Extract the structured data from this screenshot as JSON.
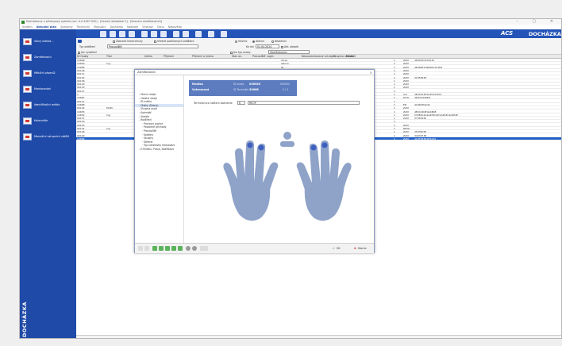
{
  "window": {
    "title": "Docházkový a přístupový systém (ver. 4.0.2467.550) - [Území/ databáze 2] - [Seznam zaměstnanců]"
  },
  "menu": [
    "Systém",
    "Aktuální plán",
    "Seznamy",
    "Technický",
    "Manuální",
    "Docházka",
    "Nástroje",
    "Výstupy",
    "Okno",
    "Nápověda"
  ],
  "menu_active_index": 1,
  "toolbar": {
    "brand": "ACS",
    "product": "DOCHÁZKA"
  },
  "sidebar": {
    "items": [
      {
        "label": "Volný dokkol...",
        "icon": "monitor-icon"
      },
      {
        "label": "Zaměstnanci",
        "icon": "people-icon"
      },
      {
        "label": "Měsíční zásení2",
        "icon": "calendar-icon"
      },
      {
        "label": "Montorování",
        "icon": "monitor-icon"
      },
      {
        "label": "Identifikační média",
        "icon": "card-icon"
      },
      {
        "label": "Kalendáře",
        "icon": "calendar-icon"
      },
      {
        "label": "Manuální vstupních zátěží",
        "icon": "list-icon"
      }
    ],
    "vertical_label": "DOCHÁZKA"
  },
  "filters": {
    "structure_label": "Zobrazit hierarchicky",
    "include_sub_label": "Včetně podřízených oddělení",
    "type_label": "Typ oddělení",
    "type_value": "Pracoviště",
    "radio_all": "Všichni",
    "radio_active": "Aktivní",
    "radio_inactive": "Neaktivní",
    "date_label": "Ke dni",
    "date_value": "01.04.2024",
    "aktiv_label": "Akt. období",
    "left_chk": "Jen vyzdílení",
    "left_chk2": "Jen typ osoby",
    "person_type": "Zaměstnanec"
  },
  "grid": {
    "headers": [
      "ID Osoby",
      "Titul",
      "Jméno",
      "Příjmení",
      "Příjmení a jméno",
      "Stav os.",
      "Pracoviště",
      "Login",
      "Nesoustrukovaný od segm.",
      "Skupina uživatelů",
      "Média"
    ],
    "rows": [
      [
        "10608",
        "",
        "",
        "",
        "",
        "",
        "",
        "dlova",
        "",
        "1",
        "ZAM",
        "465543C4A1032"
      ],
      [
        "10659",
        "Ing.",
        "",
        "",
        "",
        "",
        "",
        "elkova",
        "",
        "1",
        "ZAM",
        ""
      ],
      [
        "10689",
        "",
        "",
        "",
        "",
        "",
        "",
        "lik",
        "",
        "1",
        "ZAM",
        "4E485E7A9E06C3C3D6"
      ],
      [
        "90126",
        "",
        "",
        "",
        "",
        "",
        "",
        "",
        "",
        "1",
        "ZAM",
        ""
      ],
      [
        "90111",
        "",
        "",
        "",
        "",
        "",
        "",
        "",
        "",
        "1",
        "ZAM",
        ""
      ],
      [
        "90154",
        "",
        "",
        "",
        "",
        "",
        "",
        "lu",
        "",
        "1",
        "ZAM",
        "32350636"
      ],
      [
        "90146",
        "",
        "",
        "",
        "",
        "",
        "",
        "",
        "",
        "1",
        "ZAM",
        ""
      ],
      [
        "90129",
        "",
        "",
        "",
        "",
        "",
        "",
        "lutova",
        "",
        "1",
        "ZAM",
        ""
      ],
      [
        "90130",
        "",
        "",
        "",
        "",
        "",
        "",
        "",
        "",
        "1",
        "ZAM",
        ""
      ],
      [
        "90127",
        "",
        "",
        "",
        "",
        "",
        "",
        "",
        "",
        "1",
        "",
        ""
      ],
      [
        "1",
        "",
        "",
        "",
        "",
        "",
        "",
        "llchacek",
        "",
        "1",
        "ALL",
        "3E4551455A45333031"
      ],
      [
        "10687",
        "",
        "",
        "",
        "",
        "",
        "",
        "ocaB",
        "",
        "1",
        "DOH",
        "3D3244494B"
      ],
      [
        "90147",
        "",
        "",
        "",
        "",
        "",
        "",
        "",
        "",
        "1",
        "",
        ""
      ],
      [
        "10668",
        "",
        "",
        "",
        "",
        "",
        "",
        "lalova",
        "",
        "1",
        "ED",
        "4C4D4E4A4C"
      ],
      [
        "90124",
        "MUDr.",
        "",
        "",
        "",
        "",
        "",
        "ovicky",
        "",
        "1",
        "ZAM",
        ""
      ],
      [
        "10655",
        "",
        "",
        "",
        "",
        "",
        "",
        "ra",
        "",
        "1",
        "ZAM",
        "4E4C4D4E4A4B4E"
      ],
      [
        "10652",
        "Ing.",
        "",
        "",
        "",
        "",
        "",
        "el",
        "",
        "1",
        "ZAM",
        "534E4C4A4A4E4C4D1A4E4C4A4E4E"
      ],
      [
        "90137",
        "",
        "",
        "",
        "",
        "",
        "",
        "ada",
        "",
        "1",
        "ZAM",
        "37363930"
      ],
      [
        "90150",
        "",
        "",
        "",
        "",
        "",
        "",
        "",
        "",
        "1",
        "",
        ""
      ],
      [
        "90123",
        "",
        "",
        "",
        "",
        "",
        "",
        "ucek",
        "",
        "1",
        "ZAM",
        ""
      ],
      [
        "90122",
        "Ing.",
        "",
        "",
        "",
        "",
        "",
        "lomina",
        "",
        "1",
        "REXO",
        ""
      ],
      [
        "90148",
        "",
        "",
        "",
        "",
        "",
        "",
        "nazalova",
        "",
        "1",
        "ZAM",
        "35335036"
      ],
      [
        "90140",
        "",
        "",
        "",
        "",
        "",
        "",
        "oo",
        "",
        "1",
        "ZAM",
        "34333738"
      ],
      [
        "10666",
        "",
        "",
        "",
        "",
        "",
        "",
        "louskalova",
        "",
        "1",
        "ZAM",
        "4C4F4E4E4D5230"
      ]
    ],
    "selected_row_index": 23
  },
  "dialog": {
    "title": "Zaměstnanec",
    "tree": [
      {
        "label": "Hlavní údaje",
        "level": 0
      },
      {
        "label": "Ostatní údaje",
        "level": 0
      },
      {
        "label": "ID média",
        "level": 0
      },
      {
        "label": "Otisky (Skeny)",
        "level": 0,
        "selected": true
      },
      {
        "label": "Skupina osob",
        "level": 0
      },
      {
        "label": "Kalendář",
        "level": 0
      },
      {
        "label": "Vozidla",
        "level": 0
      },
      {
        "label": "Rozšíření",
        "level": 0
      },
      {
        "label": "Pracovní pozice",
        "level": 1
      },
      {
        "label": "Povolené příchody",
        "level": 1
      },
      {
        "label": "Pracoviště",
        "level": 1
      },
      {
        "label": "Kolektiv",
        "level": 1
      },
      {
        "label": "Skupiny",
        "level": 1
      },
      {
        "label": "Střetné",
        "level": 1
      },
      {
        "label": "Typ nárokovky stravování",
        "level": 1
      },
      {
        "label": "E-Portálu, Práva, Notifikace",
        "level": 0
      }
    ],
    "card": {
      "first_label": "Jméno",
      "first_value": "Monika",
      "last_label": "Příjmení",
      "last_value": "Vytrnarová",
      "id_label": "ID osoby",
      "id_value": "030045",
      "id2_label": "ID Terminálu",
      "id2_value": "30068",
      "code_value": "000002",
      "code2_value": "4 / 3"
    },
    "terminal_label": "Terminál pro načtení biometrie",
    "terminal_num": "6",
    "terminal_name": "REOP",
    "ok_label": "OK",
    "cancel_label": "Storno"
  },
  "colors": {
    "brand_blue": "#1f4aa8",
    "hand": "#8fa3c9",
    "finger_active": "#3d5fbf",
    "selection": "#2060c8"
  }
}
